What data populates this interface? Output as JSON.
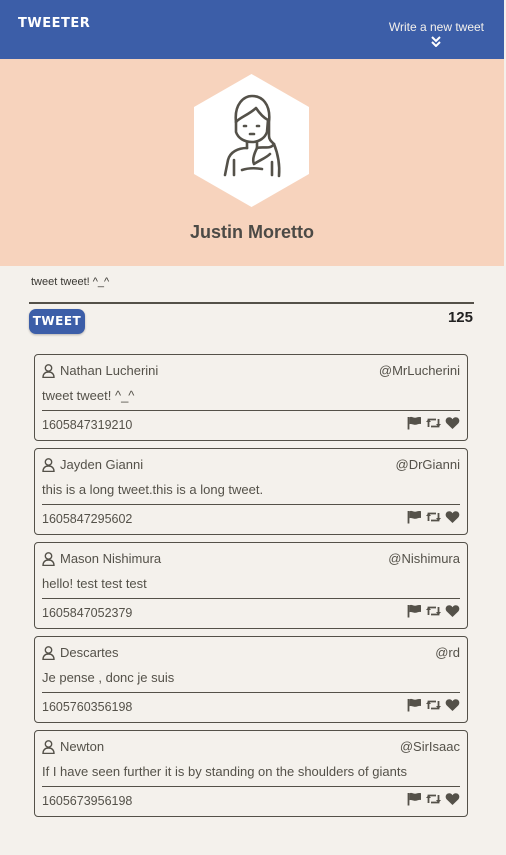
{
  "nav": {
    "brand": "TWEETER",
    "write_label": "Write a new tweet",
    "write_icon": "double-chevron-down-icon"
  },
  "profile": {
    "name": "Justin Moretto",
    "avatar_icon": "woman-avatar-icon"
  },
  "compose": {
    "text": "tweet tweet! ^_^",
    "button_label": "TWEET",
    "counter": "125"
  },
  "tweets": [
    {
      "name": "Nathan Lucherini",
      "handle": "@MrLucherini",
      "text": "tweet tweet! ^_^",
      "timestamp": "1605847319210"
    },
    {
      "name": "Jayden Gianni",
      "handle": "@DrGianni",
      "text": "this is a long tweet.this is a long tweet.",
      "timestamp": "1605847295602"
    },
    {
      "name": "Mason Nishimura",
      "handle": "@Nishimura",
      "text": "hello! test test test",
      "timestamp": "1605847052379"
    },
    {
      "name": "Descartes",
      "handle": "@rd",
      "text": "Je pense , donc je suis",
      "timestamp": "1605760356198"
    },
    {
      "name": "Newton",
      "handle": "@SirIsaac",
      "text": "If I have seen further it is by standing on the shoulders of giants",
      "timestamp": "1605673956198"
    }
  ],
  "colors": {
    "nav": "#3c5ea8",
    "profile_bg": "#f7d3bd",
    "page_bg": "#f4f1ec",
    "text": "#545149"
  }
}
